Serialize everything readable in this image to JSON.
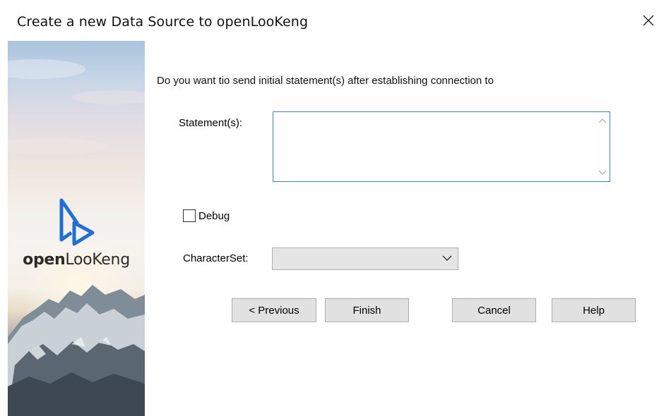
{
  "window": {
    "title": "Create a new Data Source to openLooKeng",
    "close_glyph": "✕"
  },
  "banner": {
    "logo_text_bold": "open",
    "logo_text_regular": "LooKeng",
    "logo_color": "#1e6fd9"
  },
  "form": {
    "question": "Do you want tio send initial statement(s) after establishing connection to",
    "statement_label": "Statement(s):",
    "statement_value": "",
    "debug_label": "Debug",
    "debug_checked": false,
    "charset_label": "CharacterSet:",
    "charset_value": ""
  },
  "buttons": {
    "previous": "< Previous",
    "finish": "Finish",
    "cancel": "Cancel",
    "help": "Help"
  },
  "icons": {
    "scroll_up": "chevron-up-icon",
    "scroll_down": "chevron-down-icon",
    "dropdown": "chevron-down-icon",
    "close": "close-icon"
  },
  "colors": {
    "accent_border": "#3c84d6",
    "button_bg": "#e1e1e1",
    "select_bg": "#e5e5e5"
  }
}
